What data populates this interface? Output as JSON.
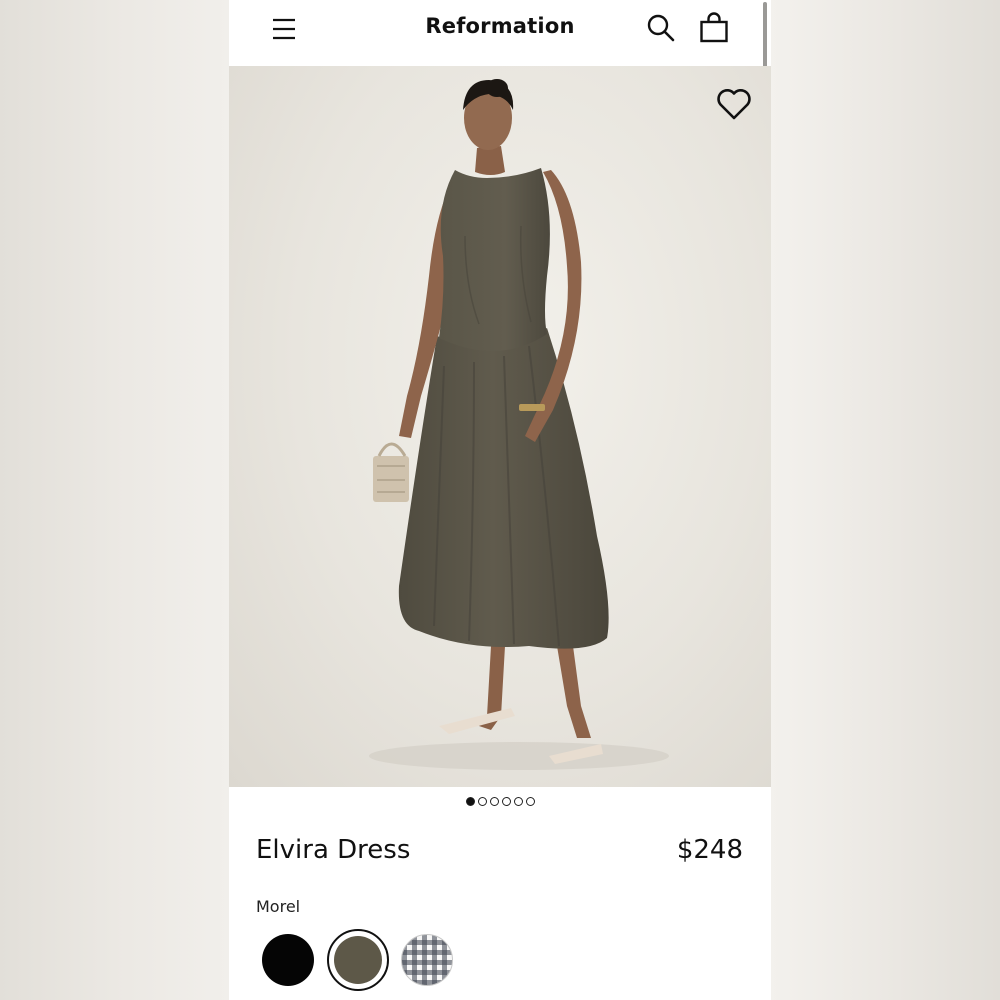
{
  "header": {
    "brand": "Reformation",
    "menu_icon": "hamburger-menu-icon",
    "search_icon": "search-icon",
    "bag_icon": "shopping-bag-icon"
  },
  "gallery": {
    "image_index": 1,
    "image_count": 6,
    "favorite_icon": "heart-outline-icon"
  },
  "product": {
    "name": "Elvira Dress",
    "price": "$248",
    "selected_color": "Morel"
  },
  "swatches": [
    {
      "name": "black",
      "color": "#050505",
      "selected": false
    },
    {
      "name": "morel",
      "color": "#5d5848",
      "selected": true
    },
    {
      "name": "gingham",
      "color": "#3c424e",
      "selected": false
    }
  ],
  "colors": {
    "dress": "#5a5648",
    "backdrop": "#ebe8e1",
    "text": "#111111"
  }
}
